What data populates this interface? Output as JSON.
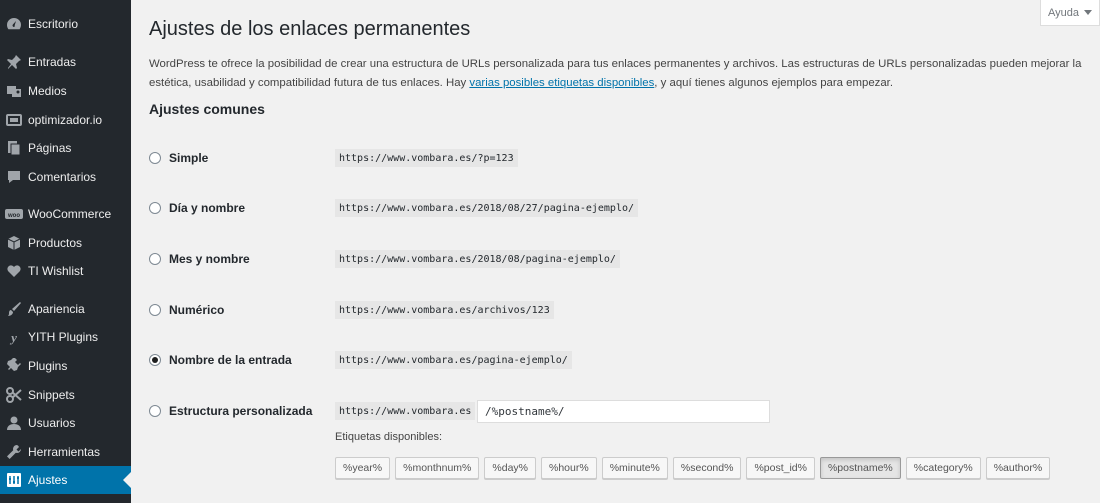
{
  "sidebar": {
    "items": [
      {
        "label": "Escritorio",
        "icon": "dashboard-icon"
      },
      {
        "label": "Entradas",
        "icon": "pin-icon"
      },
      {
        "label": "Medios",
        "icon": "media-icon"
      },
      {
        "label": "optimizador.io",
        "icon": "optimizer-icon"
      },
      {
        "label": "Páginas",
        "icon": "pages-icon"
      },
      {
        "label": "Comentarios",
        "icon": "comment-icon"
      },
      {
        "label": "WooCommerce",
        "icon": "woocommerce-icon"
      },
      {
        "label": "Productos",
        "icon": "product-box-icon"
      },
      {
        "label": "TI Wishlist",
        "icon": "heart-icon"
      },
      {
        "label": "Apariencia",
        "icon": "brush-icon"
      },
      {
        "label": "YITH Plugins",
        "icon": "yith-icon"
      },
      {
        "label": "Plugins",
        "icon": "plug-icon"
      },
      {
        "label": "Snippets",
        "icon": "snippets-icon"
      },
      {
        "label": "Usuarios",
        "icon": "user-icon"
      },
      {
        "label": "Herramientas",
        "icon": "wrench-icon"
      },
      {
        "label": "Ajustes",
        "icon": "settings-icon",
        "active": true
      }
    ]
  },
  "help": {
    "label": "Ayuda"
  },
  "page": {
    "title": "Ajustes de los enlaces permanentes",
    "intro_before": "WordPress te ofrece la posibilidad de crear una estructura de URLs personalizada para tus enlaces permanentes y archivos. Las estructuras de URLs personalizadas pueden mejorar la estética, usabilidad y compatibilidad futura de tus enlaces. Hay ",
    "intro_link": "varias posibles etiquetas disponibles",
    "intro_after": ", y aquí tienes algunos ejemplos para empezar.",
    "section_title": "Ajustes comunes"
  },
  "options": [
    {
      "label": "Simple",
      "example": "https://www.vombara.es/?p=123",
      "checked": false
    },
    {
      "label": "Día y nombre",
      "example": "https://www.vombara.es/2018/08/27/pagina-ejemplo/",
      "checked": false
    },
    {
      "label": "Mes y nombre",
      "example": "https://www.vombara.es/2018/08/pagina-ejemplo/",
      "checked": false
    },
    {
      "label": "Numérico",
      "example": "https://www.vombara.es/archivos/123",
      "checked": false
    },
    {
      "label": "Nombre de la entrada",
      "example": "https://www.vombara.es/pagina-ejemplo/",
      "checked": true
    },
    {
      "label": "Estructura personalizada",
      "example": "https://www.vombara.es",
      "checked": false
    }
  ],
  "custom": {
    "value": "/%postname%/",
    "tags_label": "Etiquetas disponibles:",
    "tags": [
      "%year%",
      "%monthnum%",
      "%day%",
      "%hour%",
      "%minute%",
      "%second%",
      "%post_id%",
      "%postname%",
      "%category%",
      "%author%"
    ],
    "active_tag": "%postname%"
  },
  "colors": {
    "sidebar_bg": "#23282d",
    "accent": "#0073aa",
    "page_bg": "#f1f1f1"
  }
}
